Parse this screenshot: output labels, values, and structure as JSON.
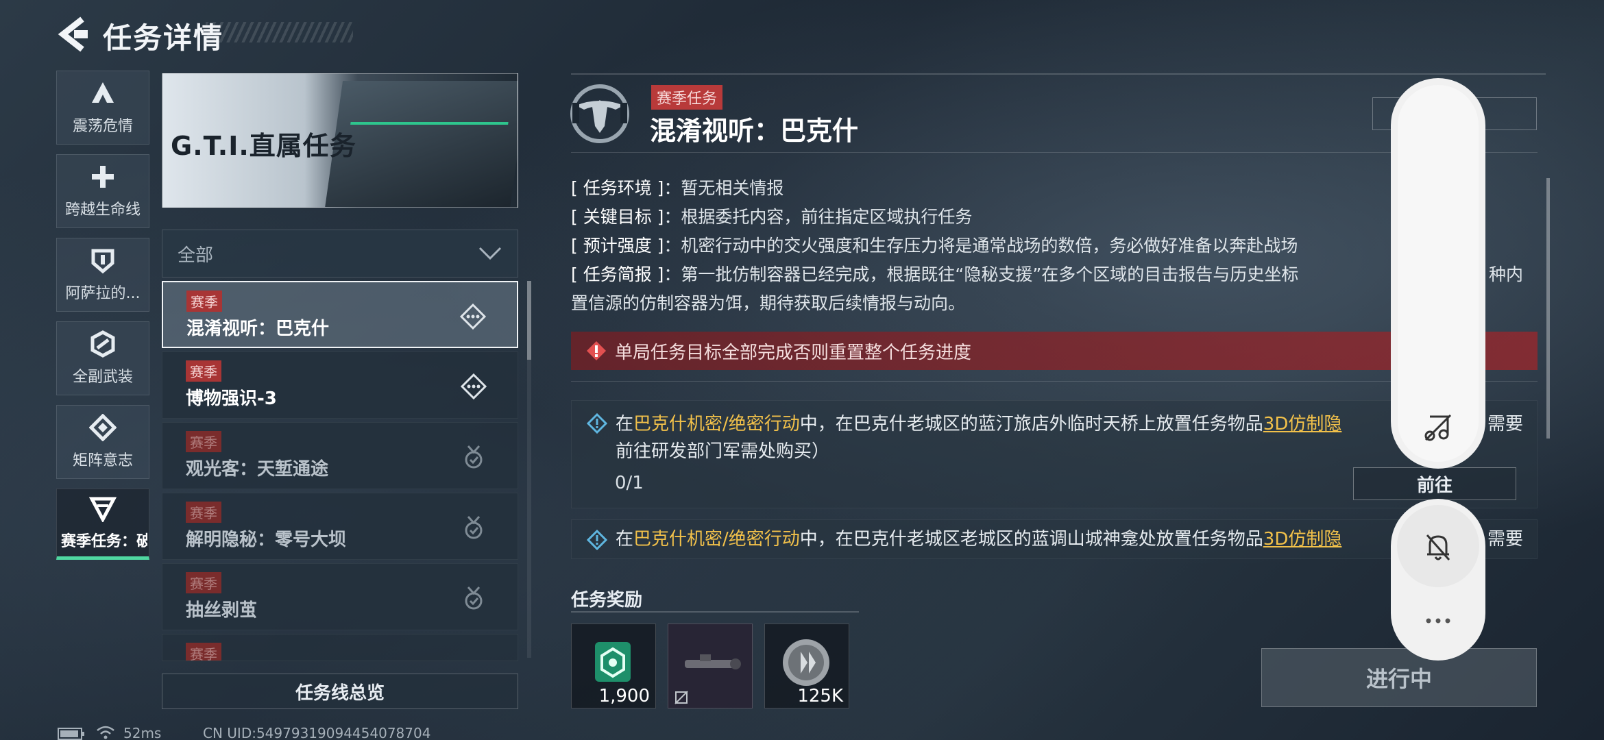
{
  "header": {
    "title": "任务详情"
  },
  "categories": [
    {
      "label": "震荡危情",
      "icon": "triangle-a-icon"
    },
    {
      "label": "跨越生命线",
      "icon": "plus-icon"
    },
    {
      "label": "阿萨拉的...",
      "icon": "shield-icon"
    },
    {
      "label": "全副武装",
      "icon": "hexagon-icon"
    },
    {
      "label": "矩阵意志",
      "icon": "diamond-icon"
    },
    {
      "label": "赛季任务：破",
      "icon": "v-triangle-icon"
    }
  ],
  "banner": {
    "title": "G.T.I.直属任务"
  },
  "filter": {
    "selected": "全部"
  },
  "tasks": [
    {
      "tag": "赛季",
      "name": "混淆视听：巴克什",
      "state": "in-progress"
    },
    {
      "tag": "赛季",
      "name": "博物强识-3",
      "state": "in-progress"
    },
    {
      "tag": "赛季",
      "name": "观光客：天堑通途",
      "state": "completed"
    },
    {
      "tag": "赛季",
      "name": "解明隐秘：零号大坝",
      "state": "completed"
    },
    {
      "tag": "赛季",
      "name": "抽丝剥茧",
      "state": "completed"
    },
    {
      "tag": "赛季",
      "name": "",
      "state": "completed"
    }
  ],
  "overview_button": "任务线总览",
  "detail": {
    "season_tag": "赛季任务",
    "title": "混淆视听：巴克什",
    "info": [
      {
        "key": "[ 任务环境 ]",
        "value": "：暂无相关情报"
      },
      {
        "key": "[ 关键目标 ]",
        "value": "：根据委托内容，前往指定区域执行任务"
      },
      {
        "key": "[ 预计强度 ]",
        "value": "：机密行动中的交火强度和生存压力将是通常战场的数倍，务必做好准备以奔赴战场"
      },
      {
        "key": "[ 任务简报 ]",
        "value": "：第一批仿制容器已经完成，根据既往“隐秘支援”在多个区域的目击报告与历史坐标"
      }
    ],
    "info_tail_a": "种内",
    "info_line5": "置信源的仿制容器为饵，期待获取后续情报与动向。",
    "warning": "单局任务目标全部完成否则重置整个任务进度",
    "objectives": [
      {
        "pre": "在",
        "highlight": "巴克什机密/绝密行动",
        "mid": "中，在巴克什老城区的蓝汀旅店外临时天桥上放置任务物品",
        "item": "3D仿制隐",
        "tail": "需要",
        "line2": "前往研发部门军需处购买）",
        "progress": "0/1"
      },
      {
        "pre": "在",
        "highlight": "巴克什机密/绝密行动",
        "mid": "中，在巴克什老城区老城区的蓝调山城神龛处放置任务物品",
        "item": "3D仿制隐",
        "tail": "需要"
      }
    ],
    "goto_button": "前往",
    "rewards_title": "任务奖励",
    "rewards": [
      {
        "name": "currency-icon",
        "count": "1,900"
      },
      {
        "name": "scope-icon",
        "count": ""
      },
      {
        "name": "coin-icon",
        "count": "125K"
      }
    ],
    "status_button": "进行中"
  },
  "overlay": {
    "icons": [
      "music-off-icon",
      "bell-off-icon",
      "more-icon"
    ]
  },
  "statusbar": {
    "ping": "52ms",
    "uid": "CN UID:54979319094454078704"
  }
}
